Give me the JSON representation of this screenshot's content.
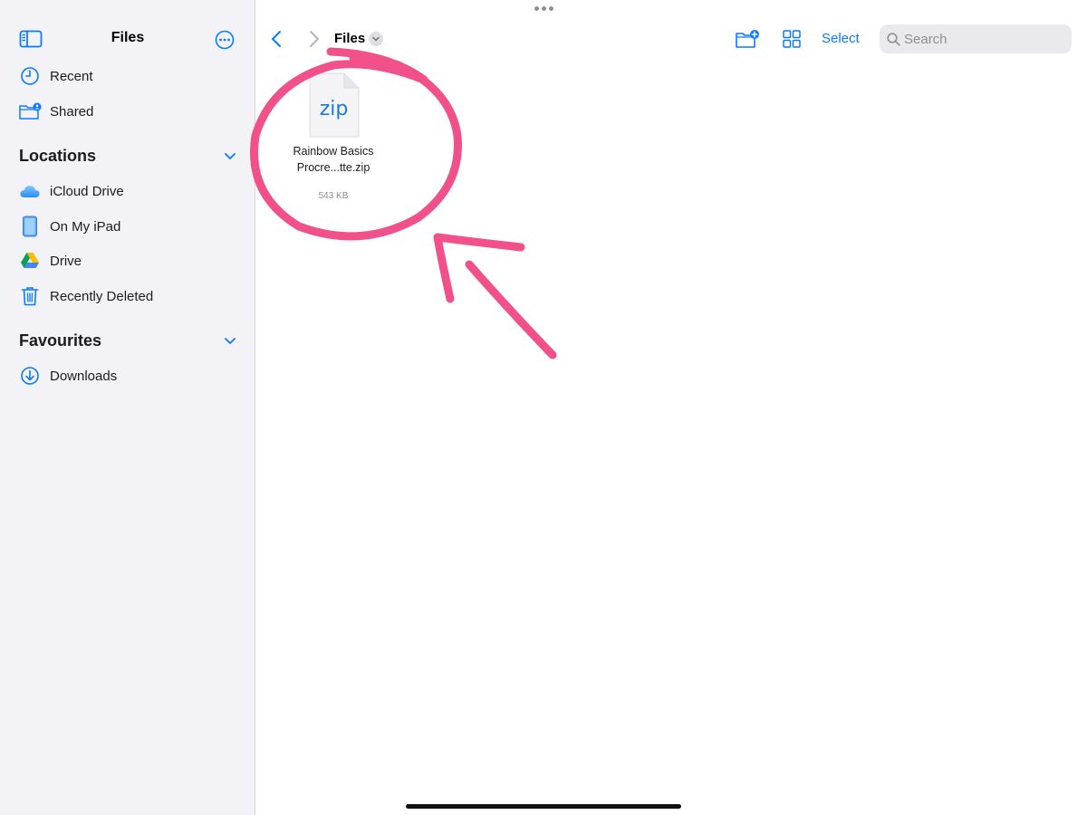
{
  "sidebar": {
    "title": "Files",
    "items_top": [
      {
        "label": "Recent",
        "icon": "clock-icon"
      },
      {
        "label": "Shared",
        "icon": "shared-folder-icon"
      }
    ],
    "locations": {
      "title": "Locations",
      "items": [
        {
          "label": "iCloud Drive",
          "icon": "icloud-icon"
        },
        {
          "label": "On My iPad",
          "icon": "ipad-icon"
        },
        {
          "label": "Drive",
          "icon": "google-drive-icon"
        },
        {
          "label": "Recently Deleted",
          "icon": "trash-icon"
        }
      ]
    },
    "favourites": {
      "title": "Favourites",
      "items": [
        {
          "label": "Downloads",
          "icon": "download-icon"
        }
      ]
    }
  },
  "toolbar": {
    "title": "Files",
    "select_label": "Select",
    "search_placeholder": "Search"
  },
  "files": [
    {
      "name_line1": "Rainbow Basics",
      "name_line2": "Procre...tte.zip",
      "size": "543 KB",
      "type_label": "zip"
    }
  ],
  "colors": {
    "accent": "#0a7aff",
    "annotation": "#f2508a",
    "sidebar_bg": "#f2f2f7"
  }
}
